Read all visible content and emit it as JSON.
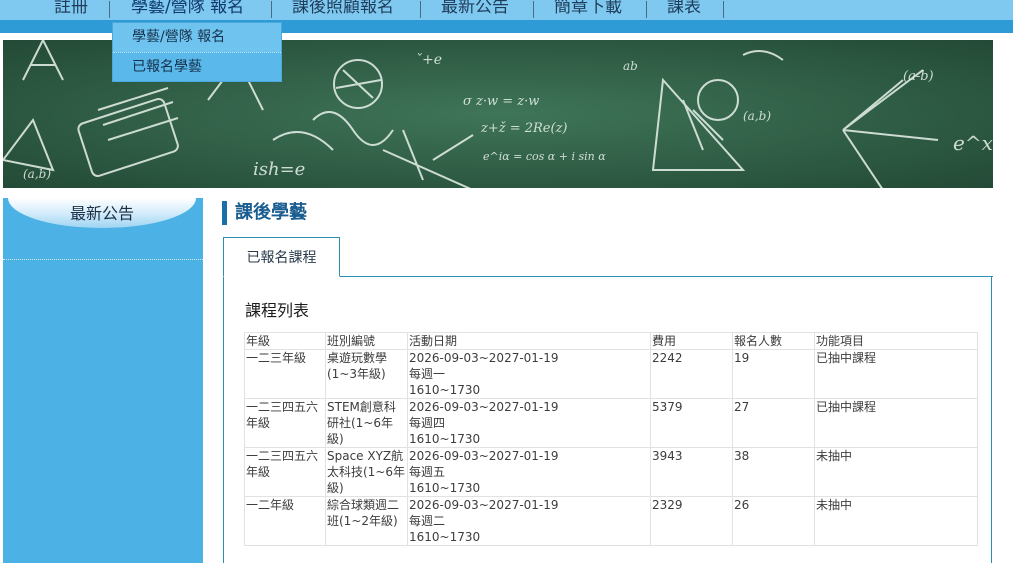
{
  "nav": {
    "items": [
      {
        "label": "註冊"
      },
      {
        "label": "學藝/營隊 報名"
      },
      {
        "label": "課後照顧報名"
      },
      {
        "label": "最新公告"
      },
      {
        "label": "簡章下載"
      },
      {
        "label": "課表"
      }
    ],
    "dropdown": [
      {
        "label": "學藝/營隊 報名"
      },
      {
        "label": "已報名學藝"
      }
    ]
  },
  "sidebar": {
    "tab_label": "最新公告"
  },
  "main": {
    "page_title": "課後學藝",
    "tab_label": "已報名課程",
    "section_title": "課程列表",
    "table": {
      "headers": [
        "年級",
        "班別編號",
        "活動日期",
        "費用",
        "報名人數",
        "功能項目"
      ],
      "rows": [
        {
          "grade": "一二三年級",
          "class_code": "桌遊玩數學(1~3年級)",
          "date_range": "2026-09-03~2027-01-19",
          "weekday": "每週一",
          "time": "1610~1730",
          "fee": "2242",
          "enrolled": "19",
          "action": "已抽中課程"
        },
        {
          "grade": "一二三四五六年級",
          "class_code": "STEM創意科研社(1~6年級)",
          "date_range": "2026-09-03~2027-01-19",
          "weekday": "每週四",
          "time": "1610~1730",
          "fee": "5379",
          "enrolled": "27",
          "action": "已抽中課程"
        },
        {
          "grade": "一二三四五六年級",
          "class_code": "Space XYZ航太科技(1~6年級)",
          "date_range": "2026-09-03~2027-01-19",
          "weekday": "每週五",
          "time": "1610~1730",
          "fee": "3943",
          "enrolled": "38",
          "action": "未抽中"
        },
        {
          "grade": "一二年級",
          "class_code": "綜合球類週二班(1~2年級)",
          "date_range": "2026-09-03~2027-01-19",
          "weekday": "每週二",
          "time": "1610~1730",
          "fee": "2329",
          "enrolled": "26",
          "action": "未抽中"
        }
      ]
    }
  },
  "colors": {
    "nav_bg": "#7fc8ef",
    "nav_strip": "#2f9bd6",
    "sidebar_bg": "#4cb2e6",
    "title_color": "#1a5d90",
    "panel_border": "#2a90b0",
    "banner_bg": "#2e5f45"
  }
}
